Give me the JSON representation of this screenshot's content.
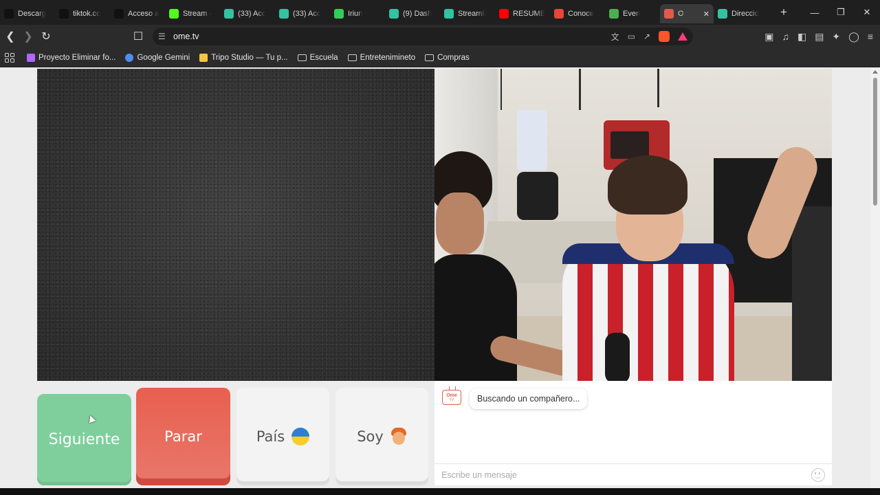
{
  "browser": {
    "tabs": [
      {
        "label": "Descarg",
        "icon": "tiktok-icon",
        "color": "#111111"
      },
      {
        "label": "tiktok.co",
        "icon": "tiktok-icon",
        "color": "#111111"
      },
      {
        "label": "Acceso a",
        "icon": "tiktok-icon",
        "color": "#111111"
      },
      {
        "label": "Stream -",
        "icon": "kick-icon",
        "color": "#53fc18"
      },
      {
        "label": "(33) Acc",
        "icon": "streamlabs-icon",
        "color": "#31c3a2"
      },
      {
        "label": "(33) Acc",
        "icon": "streamlabs-icon",
        "color": "#31c3a2"
      },
      {
        "label": "Iriun",
        "icon": "green-dot-icon",
        "color": "#2fd05a"
      },
      {
        "label": "(9) Dash",
        "icon": "streamlabs-icon",
        "color": "#31c3a2"
      },
      {
        "label": "Streamli",
        "icon": "streamlabs-icon",
        "color": "#31c3a2"
      },
      {
        "label": "RESUME",
        "icon": "youtube-icon",
        "color": "#ff0000"
      },
      {
        "label": "Conoce",
        "icon": "google-ads-icon",
        "color": "#e8443a"
      },
      {
        "label": "Even",
        "icon": "soccer-icon",
        "color": "#4caf50"
      },
      {
        "label": "O",
        "icon": "ome-tv-icon",
        "color": "#e35a4d",
        "active": true
      },
      {
        "label": "Direccio",
        "icon": "globe-icon",
        "color": "#31c3a2"
      }
    ],
    "url": "ome.tv",
    "bookmarks": [
      {
        "label": "Proyecto Eliminar fo...",
        "icon": "triangle-logo-icon"
      },
      {
        "label": "Google Gemini",
        "icon": "gemini-icon"
      },
      {
        "label": "Tripo Studio — Tu p...",
        "icon": "tripo-icon"
      },
      {
        "label": "Escuela",
        "icon": "folder-icon"
      },
      {
        "label": "Entretenimineto",
        "icon": "folder-icon"
      },
      {
        "label": "Compras",
        "icon": "folder-icon"
      }
    ]
  },
  "buttons": {
    "next": "Siguiente",
    "stop": "Parar",
    "country": "País",
    "country_flag": "ukraine-flag-icon",
    "gender": "Soy",
    "gender_icon": "boy-emoji-icon"
  },
  "chat": {
    "logo_text": "Ome",
    "logo_sub": "TV",
    "status": "Buscando un compañero...",
    "input_placeholder": "Escribe un mensaje"
  },
  "colors": {
    "next_button": "#7fcf9c",
    "stop_button": "#e8644f",
    "accent": "#e35a4d"
  }
}
